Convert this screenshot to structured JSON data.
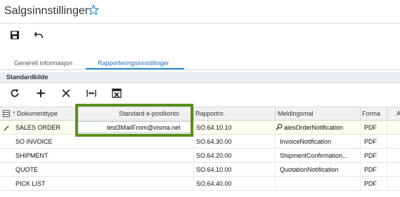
{
  "page": {
    "title": "Salgsinnstillinger"
  },
  "toolbar": {
    "save_icon": "save-icon",
    "undo_icon": "undo-icon"
  },
  "tabs": [
    {
      "label": "Generell informasjon",
      "active": false
    },
    {
      "label": "Rapporteringsinnstillinger",
      "active": true
    }
  ],
  "section": {
    "title": "Standardkilde"
  },
  "grid": {
    "tools": [
      "refresh-icon",
      "add-icon",
      "delete-icon",
      "fit-columns-icon",
      "export-excel-icon"
    ],
    "columns": {
      "required_marker": "*",
      "doc_type": "Dokumenttype",
      "email": "Standard e-postkonto",
      "report_nr": "Rapportnr.",
      "template": "Meldingsmal",
      "format": "Forma",
      "extra": "A"
    },
    "rows": [
      {
        "doc_type": "SALES ORDER",
        "email": "test3MailFrom@visma.net",
        "report_nr": "SO.64.10.10",
        "template": "alesOrderNotification",
        "format": "PDF"
      },
      {
        "doc_type": "SO INVOICE",
        "email": "",
        "report_nr": "SO.64.30.00",
        "template": "InvoiceNotification",
        "format": "PDF"
      },
      {
        "doc_type": "SHIPMENT",
        "email": "",
        "report_nr": "SO.64.20.00",
        "template": "ShipmentConfirmation...",
        "format": "PDF"
      },
      {
        "doc_type": "QUOTE",
        "email": "",
        "report_nr": "SO.64.10.00",
        "template": "QuotationNotification",
        "format": "PDF"
      },
      {
        "doc_type": "PICK LIST",
        "email": "",
        "report_nr": "SO.64.40.00",
        "template": "",
        "format": "PDF"
      }
    ]
  },
  "colors": {
    "accent": "#2b8ad3",
    "highlight": "#5a8f1a"
  }
}
